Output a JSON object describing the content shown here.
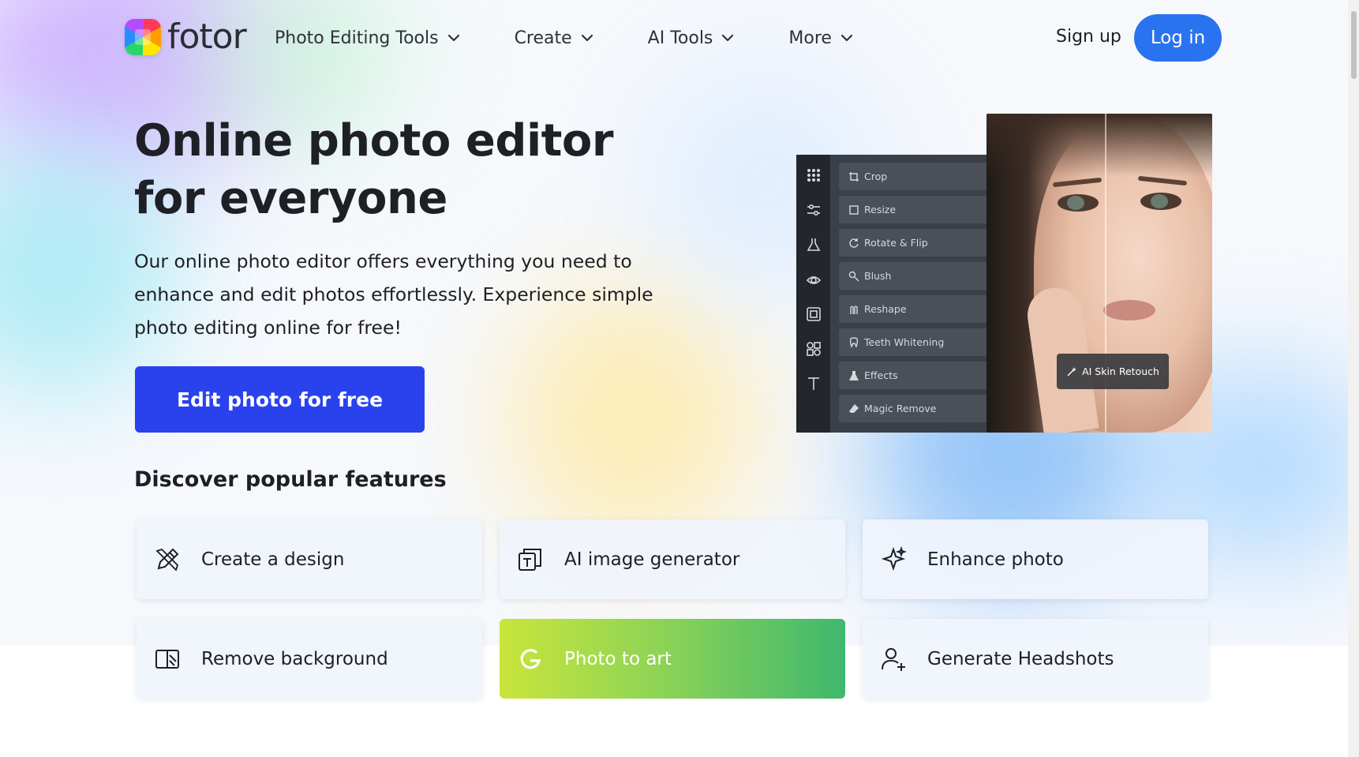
{
  "colors": {
    "accent_blue": "#2a73f0",
    "cta_blue": "#2a42ee",
    "photo_to_art_gradient_start": "#c9e53b",
    "photo_to_art_gradient_end": "#3fb86e",
    "text_dark": "#1e1f24"
  },
  "header": {
    "logo_text": "fotor",
    "nav": [
      {
        "label": "Photo Editing Tools",
        "icon": "chevron-down-icon"
      },
      {
        "label": "Create",
        "icon": "chevron-down-icon"
      },
      {
        "label": "AI Tools",
        "icon": "chevron-down-icon"
      },
      {
        "label": "More",
        "icon": "chevron-down-icon"
      }
    ],
    "signup_label": "Sign up",
    "login_label": "Log in"
  },
  "hero": {
    "title": "Online photo editor for everyone",
    "description": "Our online photo editor offers everything you need to enhance and edit photos effortlessly. Experience simple photo editing online for free!",
    "cta_label": "Edit photo for free",
    "editor_tools": [
      {
        "label": "Crop",
        "icon": "crop-icon"
      },
      {
        "label": "Resize",
        "icon": "resize-icon"
      },
      {
        "label": "Rotate & Flip",
        "icon": "rotate-icon"
      },
      {
        "label": "Blush",
        "icon": "blush-icon"
      },
      {
        "label": "Reshape",
        "icon": "reshape-icon"
      },
      {
        "label": "Teeth Whitening",
        "icon": "teeth-icon"
      },
      {
        "label": "Effects",
        "icon": "effects-icon"
      },
      {
        "label": "Magic Remove",
        "icon": "eraser-icon"
      }
    ],
    "rail_icons": [
      "grid-icon",
      "sliders-icon",
      "flask-icon",
      "eye-icon",
      "frame-icon",
      "shapes-icon",
      "text-icon"
    ],
    "skin_retouch_label": "AI Skin Retouch"
  },
  "features": {
    "heading": "Discover popular features",
    "items": [
      {
        "label": "Create a design",
        "icon": "pencil-ruler-icon"
      },
      {
        "label": "AI image generator",
        "icon": "ai-image-icon"
      },
      {
        "label": "Enhance photo",
        "icon": "sparkle-icon"
      },
      {
        "label": "Remove background",
        "icon": "remove-bg-icon"
      },
      {
        "label": "Photo to art",
        "icon": "art-icon"
      },
      {
        "label": "Generate Headshots",
        "icon": "user-plus-icon"
      }
    ]
  }
}
